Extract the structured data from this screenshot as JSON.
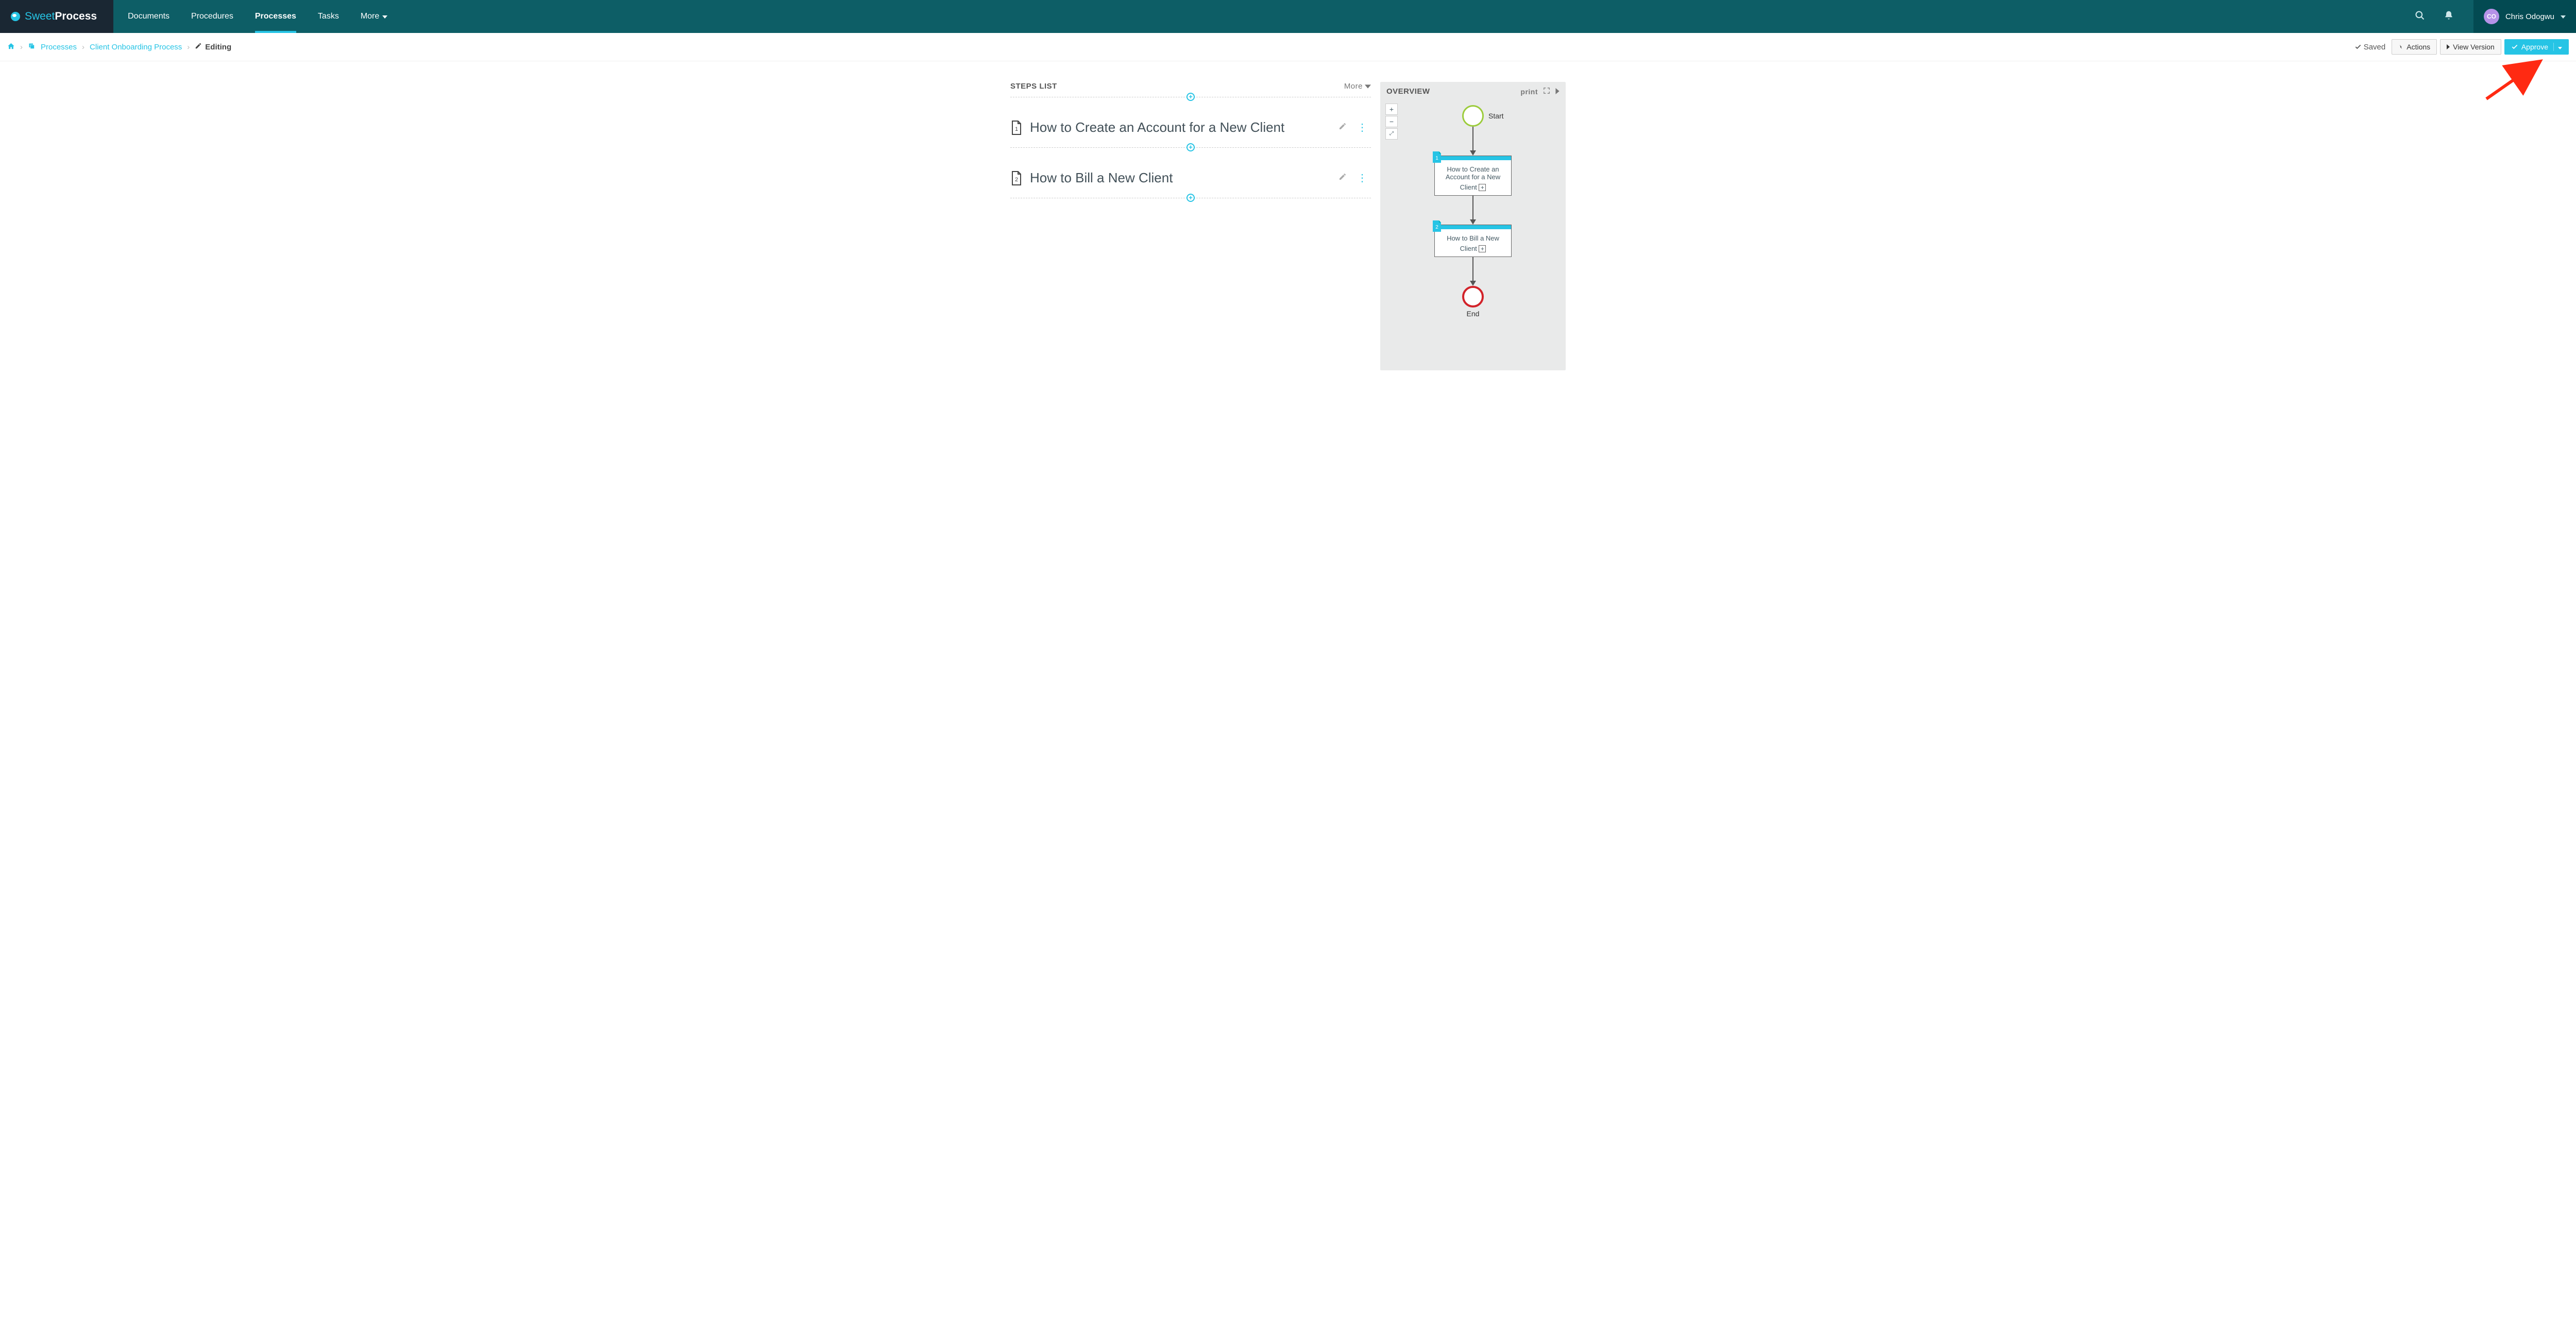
{
  "brand": {
    "sweet": "Sweet",
    "process": "Process"
  },
  "nav": {
    "items": [
      "Documents",
      "Procedures",
      "Processes",
      "Tasks",
      "More"
    ],
    "active_index": 2
  },
  "user": {
    "initials": "CO",
    "name": "Chris Odogwu"
  },
  "breadcrumb": {
    "root": "Processes",
    "doc": "Client Onboarding Process",
    "state": "Editing"
  },
  "toolbar": {
    "saved": "Saved",
    "actions": "Actions",
    "view_version": "View Version",
    "approve": "Approve"
  },
  "steps_panel": {
    "title": "STEPS LIST",
    "more": "More",
    "steps": [
      {
        "number": "1",
        "title": "How to Create an Account for a New Client"
      },
      {
        "number": "2",
        "title": "How to Bill a New Client"
      }
    ]
  },
  "overview": {
    "title": "OVERVIEW",
    "print": "print",
    "start": "Start",
    "end": "End",
    "cards": [
      "How to Create an Account for a New Client",
      "How to Bill a New Client"
    ]
  }
}
